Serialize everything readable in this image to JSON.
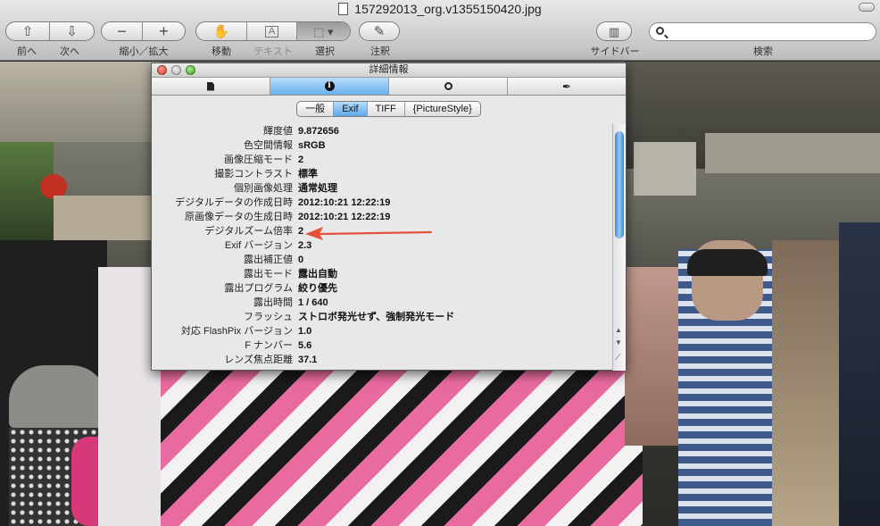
{
  "window": {
    "title": "157292013_org.v1355150420.jpg"
  },
  "toolbar": {
    "back_label": "前へ",
    "next_label": "次へ",
    "zoom_label": "縮小／拡大",
    "move_label": "移動",
    "text_label": "テキスト",
    "select_label": "選択",
    "annotate_label": "注釈",
    "sidebar_label": "サイドバー",
    "search_label": "検索",
    "search_placeholder": ""
  },
  "inspector": {
    "title": "詳細情報",
    "tabs": [
      "file-icon",
      "info-icon",
      "search-icon",
      "pen-icon"
    ],
    "active_tab": 1,
    "segments": [
      "一般",
      "Exif",
      "TIFF",
      "{PictureStyle}"
    ],
    "active_segment": 1,
    "rows": [
      {
        "key": "輝度値",
        "value": "9.872656"
      },
      {
        "key": "色空間情報",
        "value": "sRGB"
      },
      {
        "key": "画像圧縮モード",
        "value": "2"
      },
      {
        "key": "撮影コントラスト",
        "value": "標準"
      },
      {
        "key": "個別画像処理",
        "value": "通常処理"
      },
      {
        "key": "デジタルデータの作成日時",
        "value": "2012:10:21 12:22:19"
      },
      {
        "key": "原画像データの生成日時",
        "value": "2012:10:21 12:22:19"
      },
      {
        "key": "デジタルズーム倍率",
        "value": "2"
      },
      {
        "key": "Exif バージョン",
        "value": "2.3"
      },
      {
        "key": "露出補正値",
        "value": "0"
      },
      {
        "key": "露出モード",
        "value": "露出自動"
      },
      {
        "key": "露出プログラム",
        "value": "絞り優先"
      },
      {
        "key": "露出時間",
        "value": "1 / 640"
      },
      {
        "key": "フラッシュ",
        "value": "ストロボ発光せず、強制発光モード"
      },
      {
        "key": "対応 FlashPix バージョン",
        "value": "1.0"
      },
      {
        "key": "F ナンバー",
        "value": "5.6"
      },
      {
        "key": "レンズ焦点距離",
        "value": "37.1"
      }
    ]
  },
  "colors": {
    "annotation_arrow": "#e0533a",
    "selected_tab": "#68b1ee",
    "scroll_thumb": "#3d86d6"
  }
}
